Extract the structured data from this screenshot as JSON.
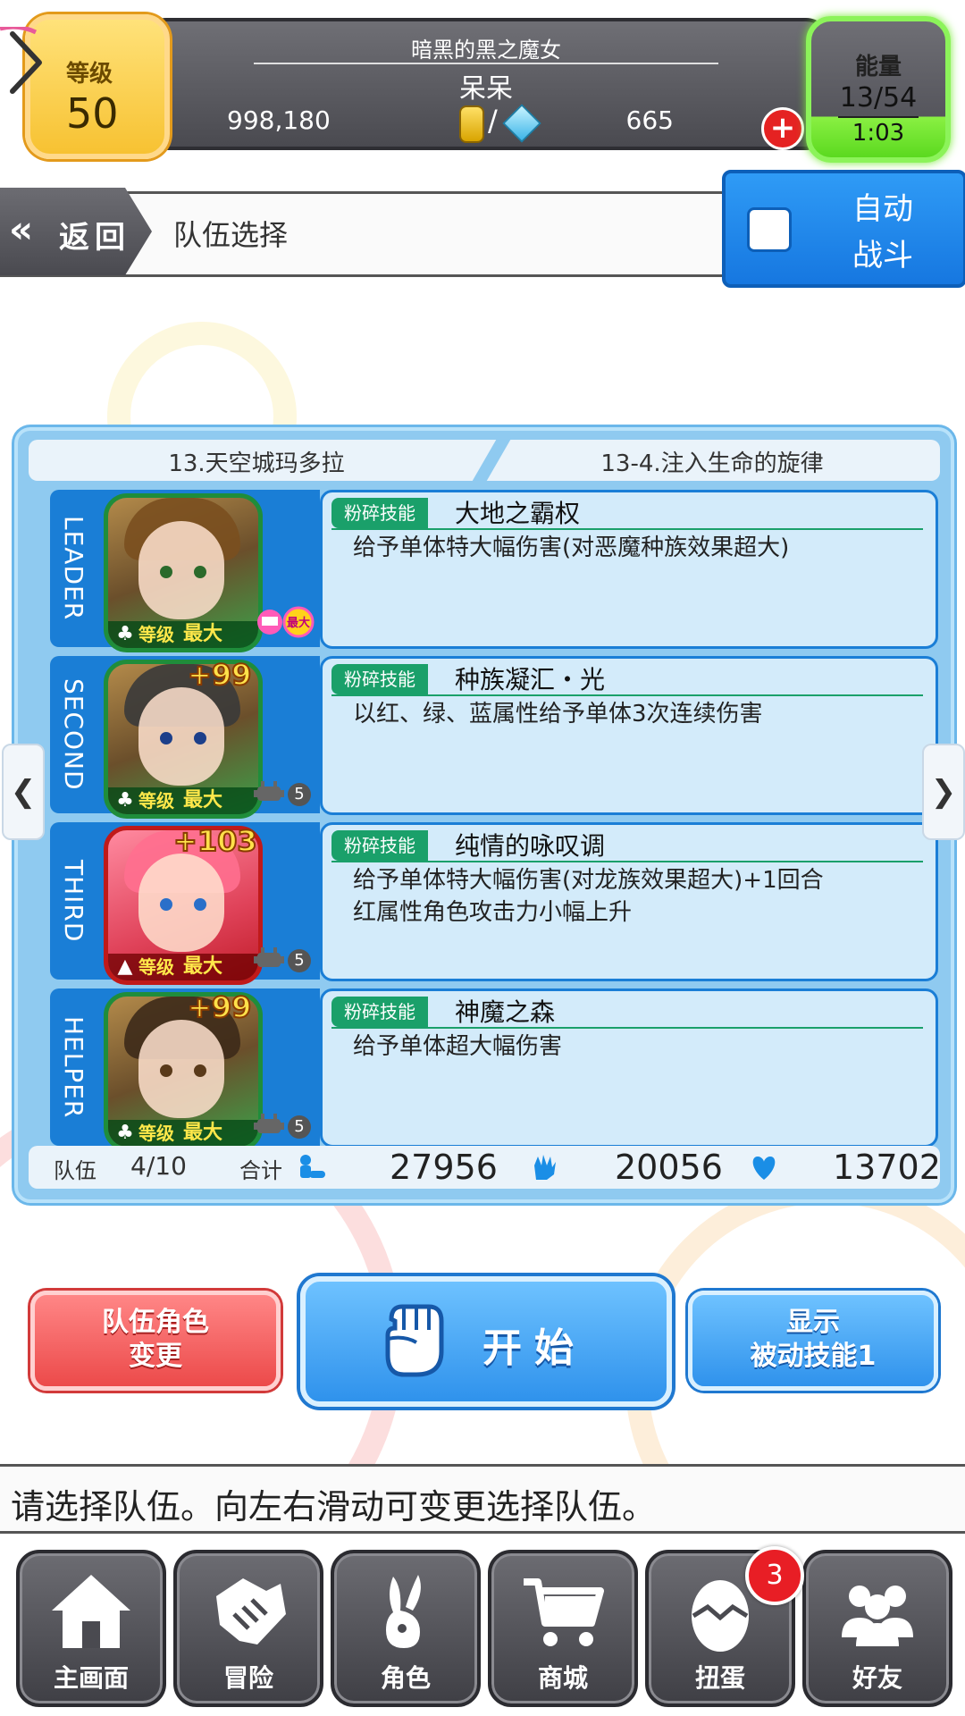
{
  "header": {
    "level_label": "等级",
    "level_value": "50",
    "player_title": "暗黑的黑之魔女",
    "player_name": "呆呆",
    "coins": "998,180",
    "gems": "665",
    "energy_label": "能量",
    "energy_value": "13/54",
    "energy_timer": "1:03"
  },
  "nav": {
    "back_label": "返回",
    "page_title": "队伍选择",
    "auto_battle_label": "自动\n战斗"
  },
  "stage": {
    "area": "13.天空城玛多拉",
    "quest": "13-4.注入生命的旋律"
  },
  "team": [
    {
      "slot": "LEADER",
      "level_label": "等级",
      "level_value": "最大",
      "plus": "",
      "badge_count": "",
      "skill_tag": "粉碎技能",
      "skill_name": "大地之霸权",
      "skill_desc": "给予单体特大幅伤害(对恶魔种族效果超大)",
      "max_badge": "最大"
    },
    {
      "slot": "SECOND",
      "level_label": "等级",
      "level_value": "最大",
      "plus": "+99",
      "badge_count": "5",
      "skill_tag": "粉碎技能",
      "skill_name": "种族凝汇・光",
      "skill_desc": "以红、绿、蓝属性给予单体3次连续伤害"
    },
    {
      "slot": "THIRD",
      "level_label": "等级",
      "level_value": "最大",
      "plus": "+103",
      "badge_count": "5",
      "skill_tag": "粉碎技能",
      "skill_name": "纯情的咏叹调",
      "skill_desc": "给予单体特大幅伤害(对龙族效果超大)+1回合\n红属性角色攻击力小幅上升"
    },
    {
      "slot": "HELPER",
      "level_label": "等级",
      "level_value": "最大",
      "plus": "+99",
      "badge_count": "5",
      "skill_tag": "粉碎技能",
      "skill_name": "神魔之森",
      "skill_desc": "给予单体超大幅伤害"
    }
  ],
  "stats": {
    "team_label": "队伍",
    "team_value": "4/10",
    "sum_label": "合计",
    "hp": "27956",
    "attack": "20056",
    "heal": "13702"
  },
  "actions": {
    "change_member": "队伍角色\n变更",
    "start": "开始",
    "show_passive": "显示\n被动技能1"
  },
  "message": "请选择队伍。向左右滑动可变更选择队伍。",
  "bottom_nav": {
    "items": [
      {
        "label": "主画面",
        "icon": "home-icon"
      },
      {
        "label": "冒险",
        "icon": "handshake-icon"
      },
      {
        "label": "角色",
        "icon": "rabbit-icon"
      },
      {
        "label": "商城",
        "icon": "cart-icon"
      },
      {
        "label": "扭蛋",
        "icon": "egg-icon"
      },
      {
        "label": "好友",
        "icon": "friends-icon"
      }
    ],
    "gacha_badge": "3"
  },
  "colors": {
    "accent_blue": "#1a7ed6",
    "level_yellow": "#f7c232",
    "energy_green": "#5bd91f",
    "danger_red": "#ec4a4a"
  }
}
